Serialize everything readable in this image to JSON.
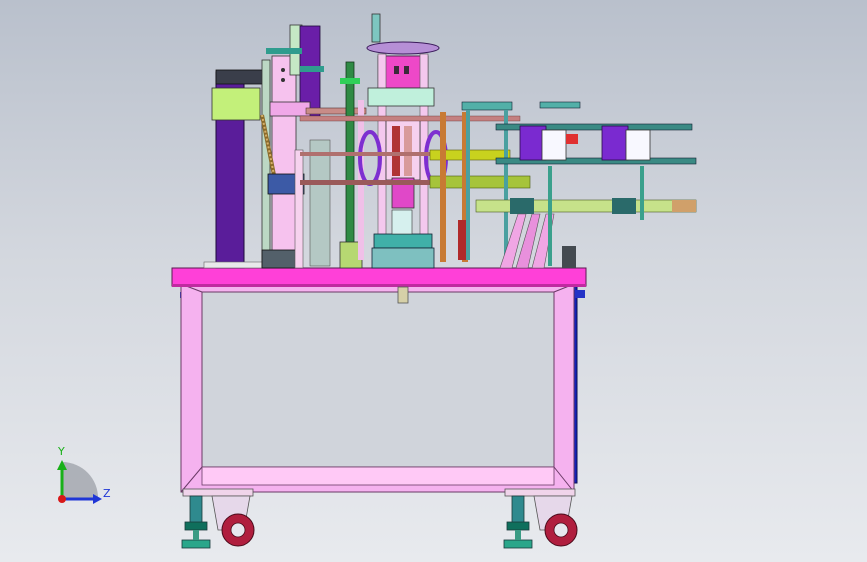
{
  "triad": {
    "y_label": "Y",
    "z_label": "Z",
    "y_color": "#18b018",
    "z_color": "#1f36d6",
    "x_color": "#d81818"
  },
  "colors": {
    "frame_pink": "#f4b4ef",
    "frame_inner": "#ffd3f9",
    "top_plate": "#ff40d8",
    "blue_post": "#1522b8",
    "purple": "#6a1ea8",
    "olive": "#c6d21c",
    "teal": "#2f9c8e",
    "wheel": "#b01e3e"
  }
}
